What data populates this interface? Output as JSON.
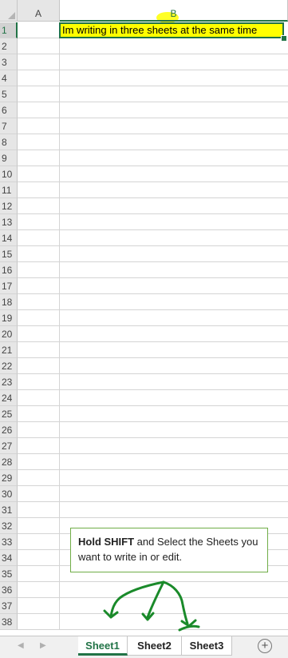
{
  "columns": [
    "A",
    "B"
  ],
  "row_numbers": [
    "1",
    "2",
    "3",
    "4",
    "5",
    "6",
    "7",
    "8",
    "9",
    "10",
    "11",
    "12",
    "13",
    "14",
    "15",
    "16",
    "17",
    "18",
    "19",
    "20",
    "21",
    "22",
    "23",
    "24",
    "25",
    "26",
    "27",
    "28",
    "29",
    "30",
    "31",
    "32",
    "33",
    "34",
    "35",
    "36",
    "37",
    "38"
  ],
  "cell_b1": "Im writing in three sheets at the same time",
  "callout": {
    "bold": "Hold SHIFT",
    "rest": " and Select the Sheets you want to write in or edit."
  },
  "tabs": [
    "Sheet1",
    "Sheet2",
    "Sheet3"
  ],
  "add_sheet_icon": "plus-circle-icon",
  "colors": {
    "accent": "#217346",
    "highlight": "#ffff00",
    "callout_border": "#70ad47",
    "arrow": "#1a8a2a"
  }
}
